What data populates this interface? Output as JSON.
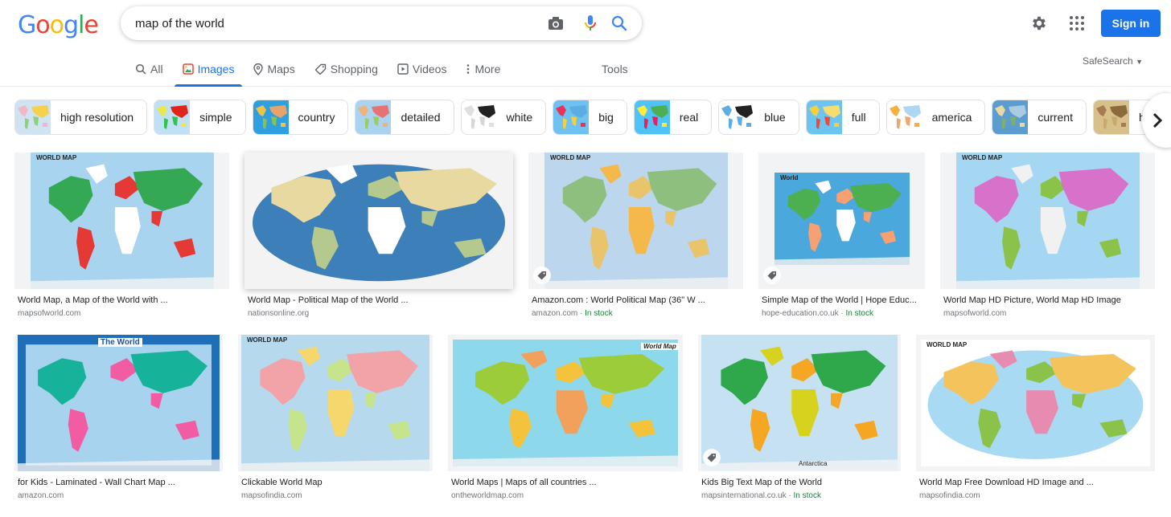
{
  "header": {
    "logo_letters": [
      {
        "ch": "G",
        "color": "#4285F4"
      },
      {
        "ch": "o",
        "color": "#EA4335"
      },
      {
        "ch": "o",
        "color": "#FBBC05"
      },
      {
        "ch": "g",
        "color": "#4285F4"
      },
      {
        "ch": "l",
        "color": "#34A853"
      },
      {
        "ch": "e",
        "color": "#EA4335"
      }
    ],
    "search_value": "map of the world",
    "search_icons": [
      "camera-icon",
      "microphone-icon",
      "search-icon"
    ],
    "sign_in_label": "Sign in",
    "safesearch_label": "SafeSearch",
    "tools_label": "Tools"
  },
  "tabs": [
    {
      "label": "All",
      "icon": "search-icon",
      "active": false
    },
    {
      "label": "Images",
      "icon": "image-icon",
      "active": true
    },
    {
      "label": "Maps",
      "icon": "map-pin-icon",
      "active": false
    },
    {
      "label": "Shopping",
      "icon": "tag-icon",
      "active": false
    },
    {
      "label": "Videos",
      "icon": "play-icon",
      "active": false
    },
    {
      "label": "More",
      "icon": "more-vert-icon",
      "active": false
    }
  ],
  "chips": [
    {
      "label": "high resolution"
    },
    {
      "label": "simple"
    },
    {
      "label": "country"
    },
    {
      "label": "detailed"
    },
    {
      "label": "white"
    },
    {
      "label": "big"
    },
    {
      "label": "real"
    },
    {
      "label": "blue"
    },
    {
      "label": "full"
    },
    {
      "label": "america"
    },
    {
      "label": "current"
    },
    {
      "label": "history"
    }
  ],
  "results": [
    {
      "title": "World Map, a Map of the World with ...",
      "source": "mapsofworld.com",
      "stock": "",
      "map_label": "WORLD MAP",
      "shopping": false
    },
    {
      "title": "World Map - Political Map of the World ...",
      "source": "nationsonline.org",
      "stock": "",
      "map_label": "",
      "shopping": false
    },
    {
      "title": "Amazon.com : World Political Map (36\" W ...",
      "source": "amazon.com",
      "stock": "In stock",
      "map_label": "WORLD MAP",
      "shopping": true
    },
    {
      "title": "Simple Map of the World | Hope Educ...",
      "source": "hope-education.co.uk",
      "stock": "In stock",
      "map_label": "World",
      "shopping": true
    },
    {
      "title": "World Map HD Picture, World Map HD Image",
      "source": "mapsofworld.com",
      "stock": "",
      "map_label": "WORLD MAP",
      "shopping": false
    },
    {
      "title": "for Kids - Laminated - Wall Chart Map ...",
      "source": "amazon.com",
      "stock": "",
      "map_label": "The World",
      "shopping": false
    },
    {
      "title": "Clickable World Map",
      "source": "mapsofindia.com",
      "stock": "",
      "map_label": "WORLD MAP",
      "shopping": false
    },
    {
      "title": "World Maps | Maps of all countries ...",
      "source": "ontheworldmap.com",
      "stock": "",
      "map_label": "World Map",
      "shopping": false
    },
    {
      "title": "Kids Big Text Map of the World",
      "source": "mapsinternational.co.uk",
      "stock": "In stock",
      "map_label": "Antarctica",
      "shopping": true
    },
    {
      "title": "World Map Free Download HD Image and ...",
      "source": "mapsofindia.com",
      "stock": "",
      "map_label": "WORLD MAP",
      "shopping": false
    }
  ],
  "separator": " · "
}
